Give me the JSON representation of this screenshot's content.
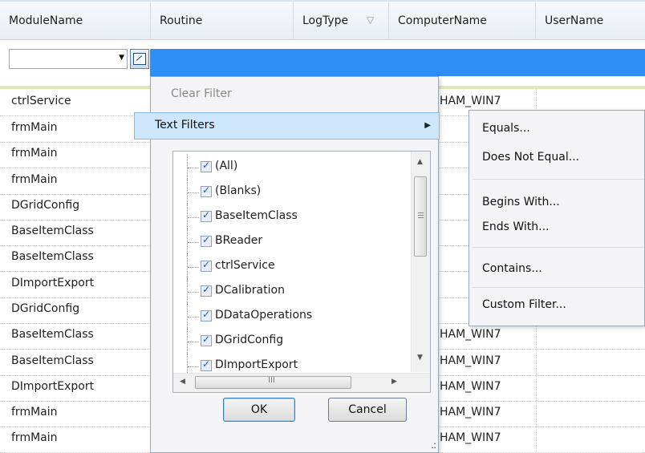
{
  "columns": [
    "ModuleName",
    "Routine",
    "LogType",
    "ComputerName",
    "UserName"
  ],
  "rows": [
    {
      "module": "ctrlService",
      "computer": "HAM_WIN7"
    },
    {
      "module": "frmMain",
      "computer": ""
    },
    {
      "module": "frmMain",
      "computer": ""
    },
    {
      "module": "frmMain",
      "computer": ""
    },
    {
      "module": "DGridConfig",
      "computer": ""
    },
    {
      "module": "BaseItemClass",
      "computer": ""
    },
    {
      "module": "BaseItemClass",
      "computer": ""
    },
    {
      "module": "DImportExport",
      "computer": ""
    },
    {
      "module": "DGridConfig",
      "computer": ""
    },
    {
      "module": "BaseItemClass",
      "computer": "HAM_WIN7"
    },
    {
      "module": "BaseItemClass",
      "computer": "HAM_WIN7"
    },
    {
      "module": "DImportExport",
      "computer": "HAM_WIN7"
    },
    {
      "module": "frmMain",
      "computer": "HAM_WIN7"
    },
    {
      "module": "frmMain",
      "computer": "HAM_WIN7"
    }
  ],
  "filter_popup": {
    "clear_filter": "Clear Filter",
    "text_filters": "Text Filters",
    "items": [
      "(All)",
      "(Blanks)",
      "BaseItemClass",
      "BReader",
      "ctrlService",
      "DCalibration",
      "DDataOperations",
      "DGridConfig",
      "DImportExport"
    ],
    "ok": "OK",
    "cancel": "Cancel"
  },
  "submenu": {
    "items": [
      "Equals...",
      "Does Not Equal...",
      "Begins With...",
      "Ends With...",
      "Contains...",
      "Custom Filter..."
    ]
  },
  "colors": {
    "filter_row": "#2e8ef5",
    "highlight": "#cde6fb"
  },
  "icons": [
    "filter-funnel-icon",
    "dropdown-arrow-icon",
    "filter-button-icon",
    "submenu-arrow-icon",
    "scroll-up-icon",
    "scroll-down-icon",
    "scroll-left-icon",
    "scroll-right-icon",
    "resize-grip-icon"
  ]
}
